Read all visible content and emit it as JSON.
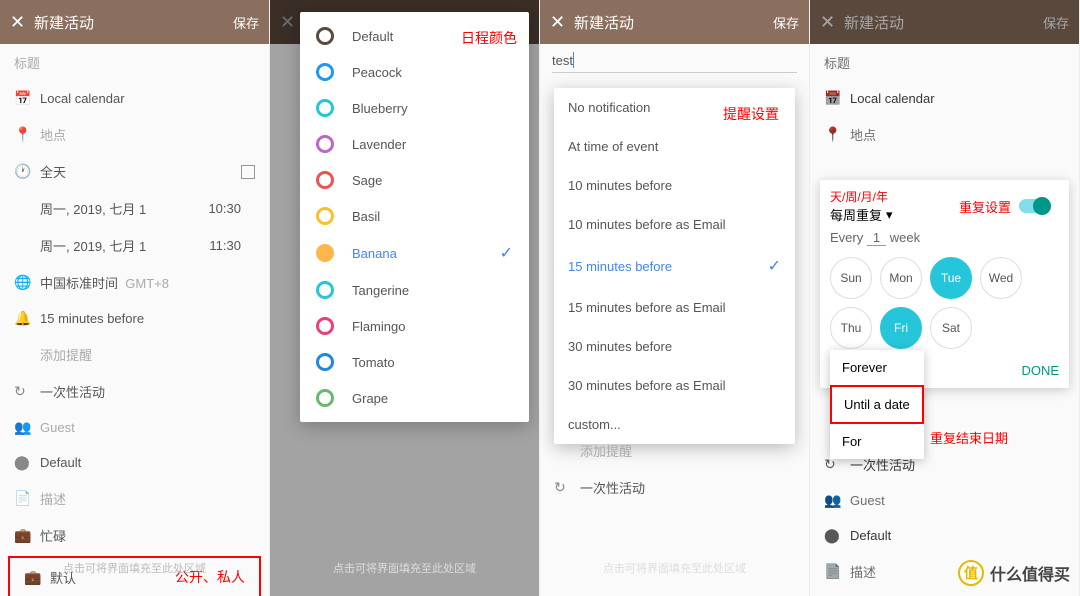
{
  "header": {
    "title": "新建活动",
    "save": "保存",
    "close": "✕"
  },
  "panel1": {
    "title_placeholder": "标题",
    "calendar": "Local calendar",
    "location": "地点",
    "allday": "全天",
    "date1": "周一, 2019, 七月 1",
    "time1": "10:30",
    "date2": "周一, 2019, 七月 1",
    "time2": "11:30",
    "tz": "中国标准时间",
    "tz_offset": "GMT+8",
    "reminder": "15 minutes before",
    "add_reminder": "添加提醒",
    "repeat": "一次性活动",
    "guest": "Guest",
    "default": "Default",
    "description": "描述",
    "busy": "忙碌",
    "visibility": "默认",
    "annotation_visibility": "公开、私人",
    "footer": "点击可将界面填充至此处区域"
  },
  "panel2": {
    "annotation": "日程颜色",
    "colors": [
      {
        "name": "Default",
        "hex": "#5a4a3f",
        "fill": false,
        "selected": false
      },
      {
        "name": "Peacock",
        "hex": "#2196f3",
        "fill": false,
        "selected": false
      },
      {
        "name": "Blueberry",
        "hex": "#26c6da",
        "fill": false,
        "selected": false
      },
      {
        "name": "Lavender",
        "hex": "#ba68c8",
        "fill": false,
        "selected": false
      },
      {
        "name": "Sage",
        "hex": "#ef5350",
        "fill": false,
        "selected": false
      },
      {
        "name": "Basil",
        "hex": "#fbc02d",
        "fill": false,
        "selected": false
      },
      {
        "name": "Banana",
        "hex": "#ffb74d",
        "fill": true,
        "selected": true
      },
      {
        "name": "Tangerine",
        "hex": "#26c6da",
        "fill": false,
        "selected": false
      },
      {
        "name": "Flamingo",
        "hex": "#ec407a",
        "fill": false,
        "selected": false
      },
      {
        "name": "Tomato",
        "hex": "#1e88e5",
        "fill": false,
        "selected": false
      },
      {
        "name": "Grape",
        "hex": "#66bb6a",
        "fill": false,
        "selected": false
      }
    ],
    "footer": "点击可将界面填充至此处区域"
  },
  "panel3": {
    "input_value": "test",
    "annotation": "提醒设置",
    "options": [
      "No notification",
      "At time of event",
      "10 minutes before",
      "10 minutes before as Email",
      "15 minutes before",
      "15 minutes before as Email",
      "30 minutes before",
      "30 minutes before as Email"
    ],
    "selected_index": 4,
    "custom": "custom...",
    "add_reminder": "添加提醒",
    "repeat": "一次性活动",
    "footer": "点击可将界面填充至此处区域"
  },
  "panel4": {
    "title_placeholder": "标题",
    "calendar": "Local calendar",
    "location": "地点",
    "repeat_top_annotation": "天/周/月/年",
    "repeat_annotation": "重复设置",
    "repeat_dropdown": "每周重复",
    "every_label": "Every",
    "every_value": "1",
    "every_unit": "week",
    "days": [
      {
        "label": "Sun",
        "on": false
      },
      {
        "label": "Mon",
        "on": false
      },
      {
        "label": "Tue",
        "on": true
      },
      {
        "label": "Wed",
        "on": false
      },
      {
        "label": "Thu",
        "on": false
      },
      {
        "label": "Fri",
        "on": true
      },
      {
        "label": "Sat",
        "on": false
      }
    ],
    "end_options": [
      "Forever",
      "Until a date",
      "For"
    ],
    "end_annotation": "重复结束日期",
    "done": "DONE",
    "repeat_row": "一次性活动",
    "guest": "Guest",
    "default": "Default",
    "description": "描述"
  },
  "watermark": "什么值得买"
}
